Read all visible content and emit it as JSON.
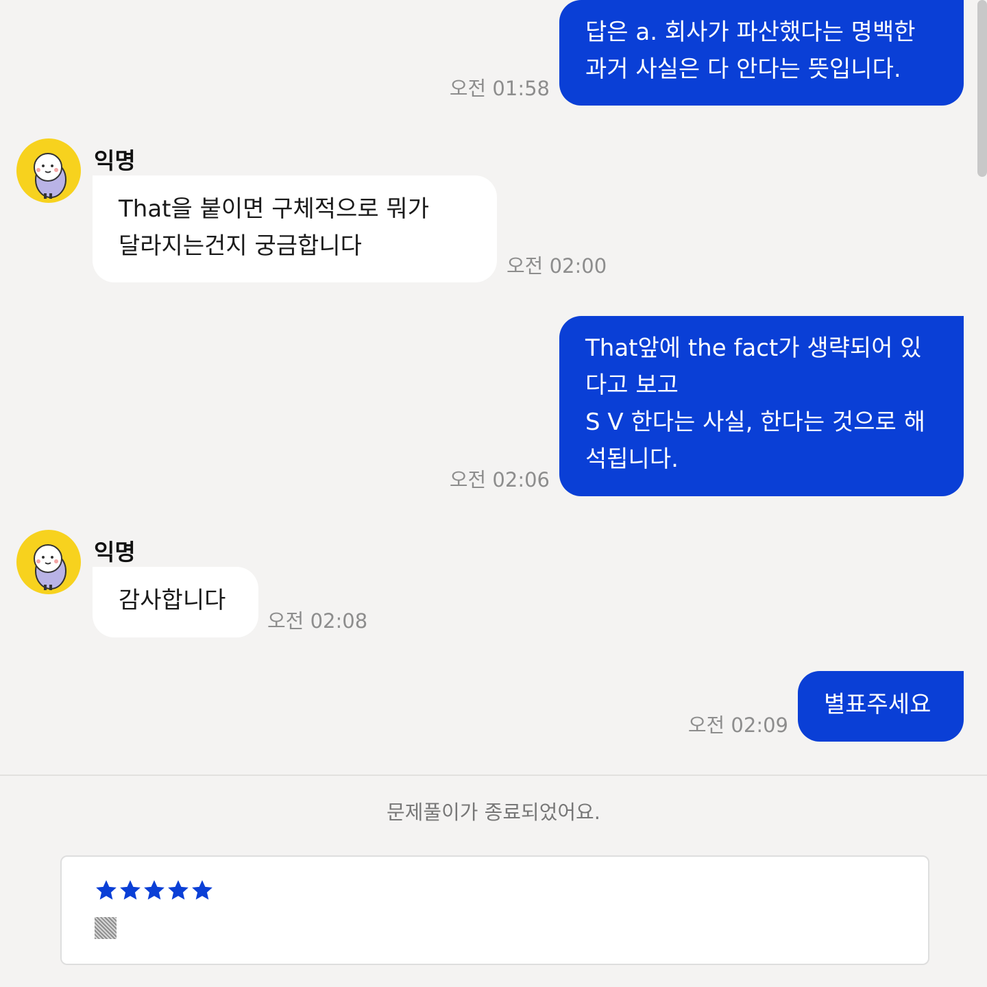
{
  "messages": [
    {
      "dir": "out",
      "text": "답은 a. 회사가 파산했다는 명백한\n과거 사실은 다 안다는 뜻입니다.",
      "time": "오전 01:58"
    },
    {
      "dir": "in",
      "sender": "익명",
      "text": "That을 붙이면 구체적으로 뭐가\n달라지는건지 궁금합니다",
      "time": "오전 02:00"
    },
    {
      "dir": "out",
      "text": "That앞에 the fact가 생략되어 있\n다고 보고\nS V 한다는 사실, 한다는 것으로 해\n석됩니다.",
      "time": "오전 02:06"
    },
    {
      "dir": "in",
      "sender": "익명",
      "text": "감사합니다",
      "time": "오전 02:08"
    },
    {
      "dir": "out",
      "text": "별표주세요",
      "time": "오전 02:09"
    }
  ],
  "end_notice": "문제풀이가 종료되었어요.",
  "review": {
    "rating": 5,
    "max_rating": 5,
    "text": "▒"
  },
  "colors": {
    "accent": "#0a3fd6",
    "avatar_bg": "#f7d21e",
    "background": "#f4f3f2"
  },
  "icons": {
    "avatar": "anonymous-character-avatar-icon",
    "star": "star-icon"
  }
}
